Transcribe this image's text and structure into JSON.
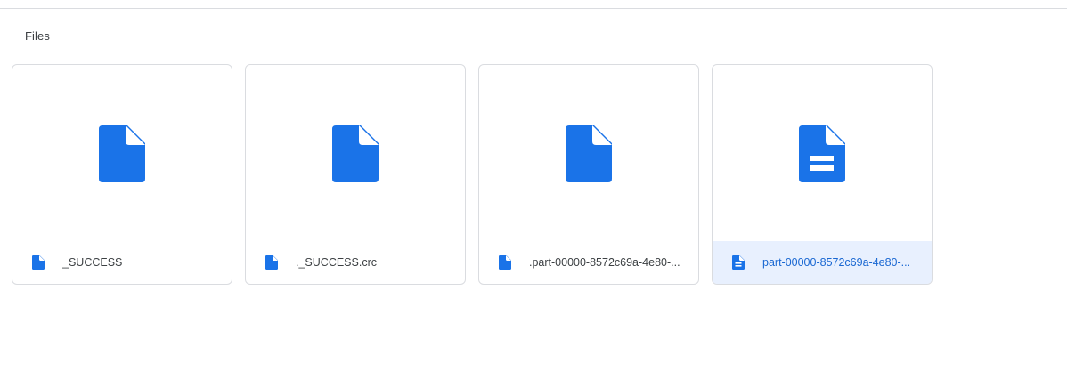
{
  "section": {
    "title": "Files"
  },
  "colors": {
    "accent": "#1a73e8",
    "selected_background": "#e8f0fe",
    "selected_text": "#1967d2",
    "border": "#dadce0",
    "text": "#3c4043"
  },
  "files": [
    {
      "name": "_SUCCESS",
      "icon": "file-icon",
      "selected": false
    },
    {
      "name": "._SUCCESS.crc",
      "icon": "file-icon",
      "selected": false
    },
    {
      "name": ".part-00000-8572c69a-4e80-...",
      "icon": "file-icon",
      "selected": false
    },
    {
      "name": "part-00000-8572c69a-4e80-...",
      "icon": "document-icon",
      "selected": true
    }
  ]
}
